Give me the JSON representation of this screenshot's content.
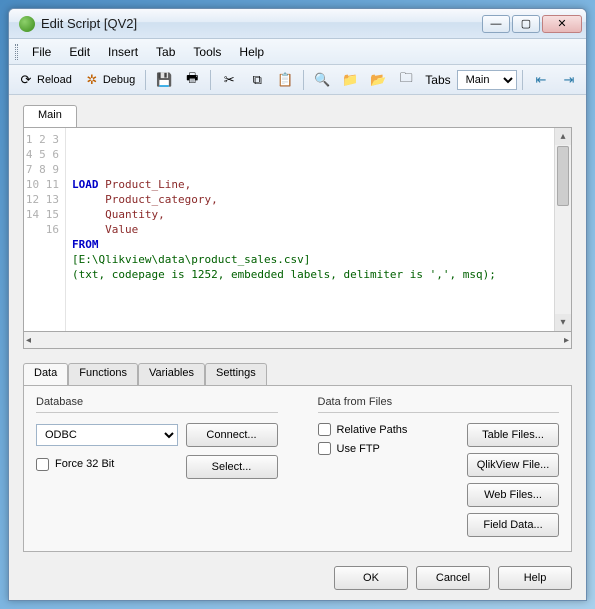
{
  "window": {
    "title": "Edit Script [QV2]"
  },
  "menus": {
    "file": "File",
    "edit": "Edit",
    "insert": "Insert",
    "tab": "Tab",
    "tools": "Tools",
    "help": "Help"
  },
  "toolbar": {
    "reload": "Reload",
    "debug": "Debug",
    "tabs_label": "Tabs",
    "tabs_value": "Main"
  },
  "editor": {
    "tab_label": "Main",
    "line_count": 16,
    "lines": {
      "l4_kw": "LOAD",
      "l4_rest": " Product_Line,",
      "l5": "     Product_category,",
      "l6": "     Quantity,",
      "l7": "     Value",
      "l8_kw": "FROM",
      "l9": "[E:\\Qlikview\\data\\product_sales.csv]",
      "l10": "(txt, codepage is 1252, embedded labels, delimiter is ',', msq);"
    }
  },
  "lower": {
    "tabs": {
      "data": "Data",
      "functions": "Functions",
      "variables": "Variables",
      "settings": "Settings"
    },
    "database": {
      "group": "Database",
      "selected": "ODBC",
      "connect": "Connect...",
      "select": "Select...",
      "force32": "Force 32 Bit"
    },
    "files": {
      "group": "Data from Files",
      "relative": "Relative Paths",
      "ftp": "Use FTP",
      "table": "Table Files...",
      "qlikview": "QlikView File...",
      "web": "Web Files...",
      "field": "Field Data..."
    }
  },
  "footer": {
    "ok": "OK",
    "cancel": "Cancel",
    "help": "Help"
  }
}
